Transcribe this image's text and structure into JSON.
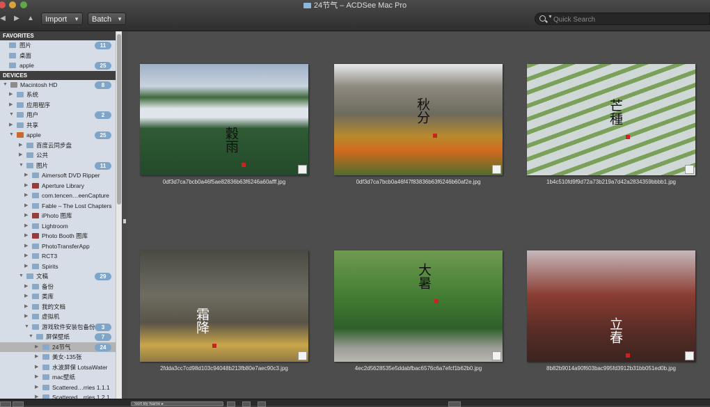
{
  "window": {
    "title": "24节气 – ACDSee Mac Pro"
  },
  "toolbar": {
    "import_label": "Import",
    "batch_label": "Batch",
    "search_placeholder": "Quick Search"
  },
  "sidebar": {
    "favorites_header": "FAVORITES",
    "favorites": [
      {
        "label": "图片",
        "count": "11"
      },
      {
        "label": "桌面",
        "count": ""
      },
      {
        "label": "apple",
        "count": "25"
      }
    ],
    "devices_header": "DEVICES",
    "tree": [
      {
        "label": "Macintosh HD",
        "count": "8",
        "depth": 0,
        "open": true,
        "icon": "disk-icon"
      },
      {
        "label": "系统",
        "count": "",
        "depth": 1,
        "open": false,
        "icon": "folder-icon"
      },
      {
        "label": "应用程序",
        "count": "",
        "depth": 1,
        "open": false,
        "icon": "folder-icon"
      },
      {
        "label": "用户",
        "count": "2",
        "depth": 1,
        "open": true,
        "icon": "folder-icon"
      },
      {
        "label": "共享",
        "count": "",
        "depth": 2,
        "open": false,
        "icon": "folder-icon"
      },
      {
        "label": "apple",
        "count": "25",
        "depth": 2,
        "open": true,
        "icon": "home-icon"
      },
      {
        "label": "百度云同步盘",
        "count": "",
        "depth": 3,
        "open": false,
        "icon": "folder-icon"
      },
      {
        "label": "公共",
        "count": "",
        "depth": 3,
        "open": false,
        "icon": "folder-icon"
      },
      {
        "label": "图片",
        "count": "11",
        "depth": 3,
        "open": true,
        "icon": "folder-icon"
      },
      {
        "label": "Aimersoft DVD Ripper",
        "count": "",
        "depth": 4,
        "open": false,
        "icon": "folder-icon"
      },
      {
        "label": "Aperture Library",
        "count": "",
        "depth": 4,
        "open": false,
        "icon": "app-icon"
      },
      {
        "label": "com.tencen…eenCapture",
        "count": "",
        "depth": 4,
        "open": false,
        "icon": "folder-icon"
      },
      {
        "label": "Fable – The Lost Chapters",
        "count": "",
        "depth": 4,
        "open": false,
        "icon": "folder-icon"
      },
      {
        "label": "iPhoto 图库",
        "count": "",
        "depth": 4,
        "open": false,
        "icon": "app-icon"
      },
      {
        "label": "Lightroom",
        "count": "",
        "depth": 4,
        "open": false,
        "icon": "folder-icon"
      },
      {
        "label": "Photo Booth 图库",
        "count": "",
        "depth": 4,
        "open": false,
        "icon": "app-icon"
      },
      {
        "label": "PhotoTransferApp",
        "count": "",
        "depth": 4,
        "open": false,
        "icon": "folder-icon"
      },
      {
        "label": "RCT3",
        "count": "",
        "depth": 4,
        "open": false,
        "icon": "folder-icon"
      },
      {
        "label": "Spirits",
        "count": "",
        "depth": 4,
        "open": false,
        "icon": "folder-icon"
      },
      {
        "label": "文稿",
        "count": "29",
        "depth": 3,
        "open": true,
        "icon": "folder-icon"
      },
      {
        "label": "备份",
        "count": "",
        "depth": 4,
        "open": false,
        "icon": "folder-icon"
      },
      {
        "label": "类库",
        "count": "",
        "depth": 4,
        "open": false,
        "icon": "folder-icon"
      },
      {
        "label": "我的文档",
        "count": "",
        "depth": 4,
        "open": false,
        "icon": "folder-icon"
      },
      {
        "label": "虚拟机",
        "count": "",
        "depth": 4,
        "open": false,
        "icon": "folder-icon"
      },
      {
        "label": "游戏软件安装包备份",
        "count": "3",
        "depth": 4,
        "open": true,
        "icon": "folder-icon"
      },
      {
        "label": "屏保壁纸",
        "count": "7",
        "depth": 5,
        "open": true,
        "icon": "folder-icon"
      },
      {
        "label": "24节气",
        "count": "24",
        "depth": 6,
        "open": false,
        "icon": "folder-icon",
        "selected": true
      },
      {
        "label": "美女-135张",
        "count": "",
        "depth": 6,
        "open": false,
        "icon": "folder-icon"
      },
      {
        "label": "水波屏保 LotsaWater",
        "count": "",
        "depth": 6,
        "open": false,
        "icon": "folder-icon"
      },
      {
        "label": "mac壁纸",
        "count": "",
        "depth": 6,
        "open": false,
        "icon": "folder-icon"
      },
      {
        "label": "Scattered…rries 1.1.1",
        "count": "",
        "depth": 6,
        "open": false,
        "icon": "folder-icon"
      },
      {
        "label": "Scattered…rries 1.2.1",
        "count": "",
        "depth": 6,
        "open": false,
        "icon": "folder-icon"
      }
    ]
  },
  "thumbnails": [
    {
      "filename": "0df3d7ca7bcb0a46f5ae82836b63f6246a60afff.jpg",
      "calligraphy": "穀雨",
      "scene": "misty-forest"
    },
    {
      "filename": "0df3d7ca7bcb0a46f47f83836b63f6246b60af2e.jpg",
      "calligraphy": "秋分",
      "scene": "autumn-mountain"
    },
    {
      "filename": "1b4c510fd9f9d72a73b219a7d42a2834359bbbb1.jpg",
      "calligraphy": "芒種",
      "scene": "rice-terraces"
    },
    {
      "filename": "2fdda3cc7cd98d103c94048b213fb80e7aec90c3.jpg",
      "calligraphy": "霜降",
      "scene": "old-building-ginkgo"
    },
    {
      "filename": "4ec2d5628535e5ddabfbac6576c6a7efcf1b62b0.jpg",
      "calligraphy": "大暑",
      "scene": "tree-lined-road"
    },
    {
      "filename": "8b82b9014a90f603bac995fd3912b31bb051ed0b.jpg",
      "calligraphy": "立春",
      "scene": "plum-blossom-house"
    }
  ],
  "statusbar": {
    "sort_label": "Sort By Name ▸"
  }
}
